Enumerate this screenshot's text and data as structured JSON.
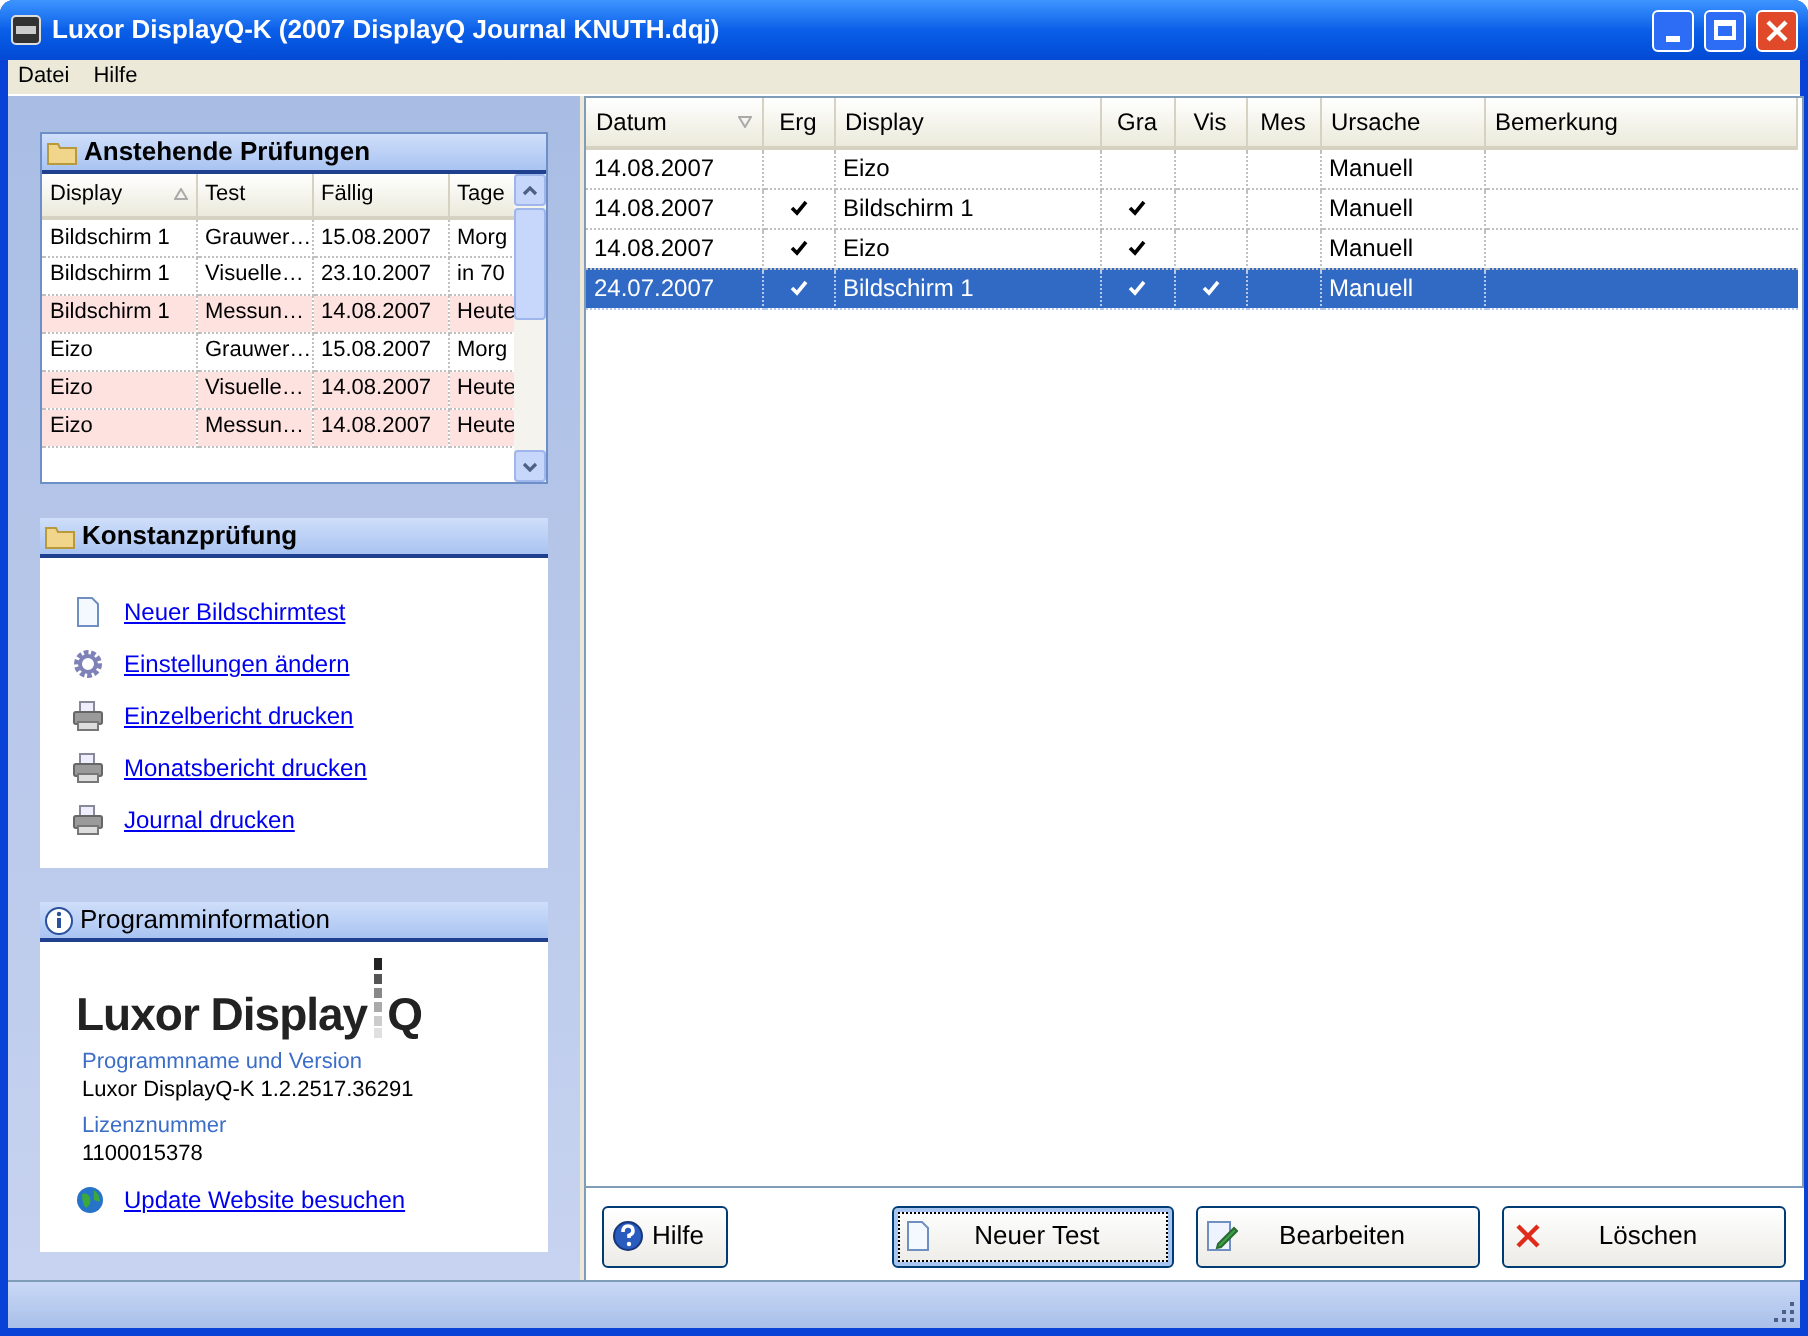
{
  "window": {
    "title": "Luxor DisplayQ-K (2007 DisplayQ Journal KNUTH.dqj)"
  },
  "menu": [
    "Datei",
    "Hilfe"
  ],
  "pending": {
    "title": "Anstehende Prüfungen",
    "columns": [
      "Display",
      "Test",
      "Fällig",
      "Tage"
    ],
    "rows": [
      {
        "cells": [
          "Bildschirm 1",
          "Grauwer…",
          "15.08.2007",
          "Morg"
        ],
        "due": false
      },
      {
        "cells": [
          "Bildschirm 1",
          "Visuelle…",
          "23.10.2007",
          "in 70"
        ],
        "due": false
      },
      {
        "cells": [
          "Bildschirm 1",
          "Messun…",
          "14.08.2007",
          "Heute"
        ],
        "due": true
      },
      {
        "cells": [
          "Eizo",
          "Grauwer…",
          "15.08.2007",
          "Morg"
        ],
        "due": false
      },
      {
        "cells": [
          "Eizo",
          "Visuelle…",
          "14.08.2007",
          "Heute"
        ],
        "due": true
      },
      {
        "cells": [
          "Eizo",
          "Messun…",
          "14.08.2007",
          "Heute"
        ],
        "due": true
      }
    ]
  },
  "actions": {
    "title": "Konstanzprüfung",
    "items": [
      {
        "label": "Neuer Bildschirmtest",
        "kind": "document"
      },
      {
        "label": "Einstellungen ändern",
        "kind": "gear"
      },
      {
        "label": "Einzelbericht drucken",
        "kind": "printer"
      },
      {
        "label": "Monatsbericht drucken",
        "kind": "printer"
      },
      {
        "label": "Journal drucken",
        "kind": "printer"
      }
    ]
  },
  "info": {
    "title": "Programminformation",
    "logo_main": "Luxor Display",
    "logo_letter": "Q",
    "fields": [
      {
        "label": "Programmname und Version",
        "value": "Luxor DisplayQ-K 1.2.2517.36291"
      },
      {
        "label": "Lizenznummer",
        "value": "1100015378"
      }
    ],
    "link": "Update Website besuchen"
  },
  "journal": {
    "columns": [
      "Datum",
      "Erg",
      "Display",
      "Gra",
      "Vis",
      "Mes",
      "Ursache",
      "Bemerkung"
    ],
    "rows": [
      {
        "datum": "14.08.2007",
        "erg": false,
        "display": "Eizo",
        "gra": false,
        "vis": false,
        "mes": false,
        "ursache": "Manuell",
        "selected": false
      },
      {
        "datum": "14.08.2007",
        "erg": true,
        "display": "Bildschirm 1",
        "gra": true,
        "vis": false,
        "mes": false,
        "ursache": "Manuell",
        "selected": false
      },
      {
        "datum": "14.08.2007",
        "erg": true,
        "display": "Eizo",
        "gra": true,
        "vis": false,
        "mes": false,
        "ursache": "Manuell",
        "selected": false
      },
      {
        "datum": "24.07.2007",
        "erg": true,
        "display": "Bildschirm 1",
        "gra": true,
        "vis": true,
        "mes": false,
        "ursache": "Manuell",
        "selected": true
      }
    ]
  },
  "buttons": [
    {
      "label": "Hilfe",
      "kind": "help",
      "focused": false
    },
    {
      "label": "Neuer Test",
      "kind": "document",
      "focused": true
    },
    {
      "label": "Bearbeiten",
      "kind": "edit",
      "focused": false
    },
    {
      "label": "Löschen",
      "kind": "delete",
      "focused": false
    }
  ]
}
